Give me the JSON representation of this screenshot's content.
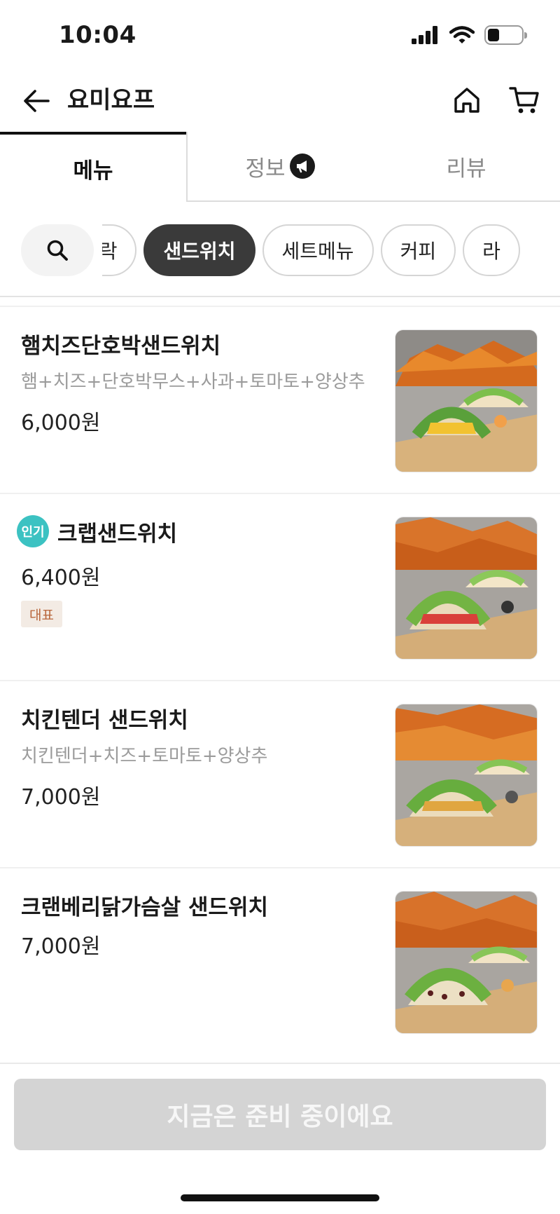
{
  "status_bar": {
    "time": "10:04",
    "battery_level": 0.35
  },
  "header": {
    "title": "요미요프"
  },
  "tabs": [
    {
      "label": "메뉴",
      "active": true
    },
    {
      "label": "정보",
      "active": false
    },
    {
      "label": "리뷰",
      "active": false
    }
  ],
  "categories": [
    {
      "label": "샐러드 도시락",
      "active": false
    },
    {
      "label": "샌드위치",
      "active": true
    },
    {
      "label": "세트메뉴",
      "active": false
    },
    {
      "label": "커피",
      "active": false
    },
    {
      "label": "라",
      "active": false
    }
  ],
  "menu_items": [
    {
      "name": "햄치즈단호박샌드위치",
      "description": "햄+치즈+단호박무스+사과+토마토+양상추",
      "price": "6,000원"
    },
    {
      "name": "크랩샌드위치",
      "badge": "인기",
      "price": "6,400원",
      "tag": "대표"
    },
    {
      "name": "치킨텐더 샌드위치",
      "description": "치킨텐더+치즈+토마토+양상추",
      "price": "7,000원"
    },
    {
      "name": "크랜베리닭가슴살 샌드위치",
      "price": "7,000원"
    }
  ],
  "cta": {
    "label": "지금은 준비 중이에요"
  },
  "colors": {
    "accent_dark": "#3a3a3a",
    "popular_badge": "#3cc2c2",
    "rep_tag_bg": "#f3ebe4",
    "rep_tag_text": "#b8653a",
    "cta_disabled": "#d4d4d4"
  },
  "icons": {
    "back": "arrow-left-icon",
    "home": "home-icon",
    "cart": "cart-icon",
    "info_badge": "megaphone-icon",
    "search": "search-icon"
  }
}
